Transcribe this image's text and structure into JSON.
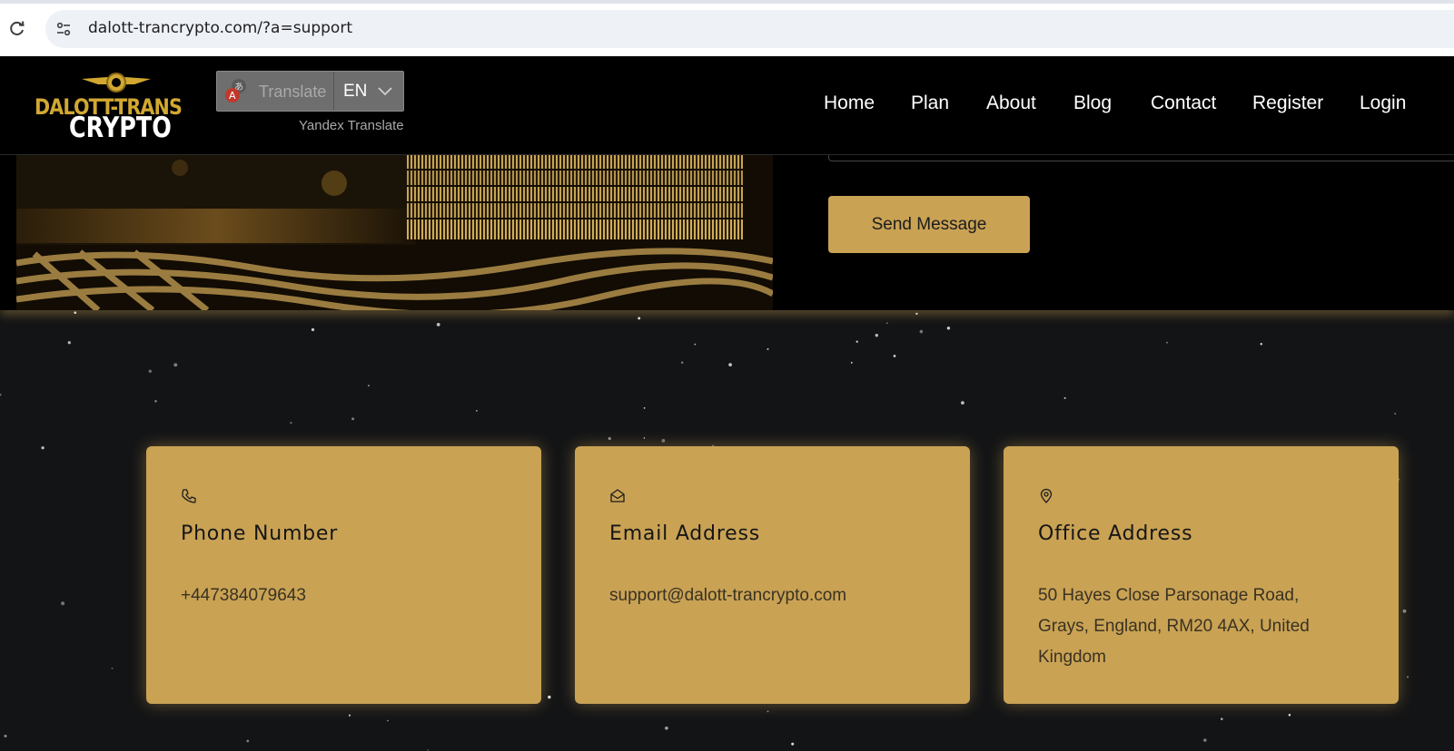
{
  "browser": {
    "url": "dalott-trancrypto.com/?a=support"
  },
  "header": {
    "logo": {
      "line1": "DALOTT-TRANS",
      "line2": "CRYPTO"
    },
    "translate": {
      "label": "Translate",
      "language": "EN",
      "provider": "Yandex Translate"
    },
    "nav": [
      {
        "label": "Home"
      },
      {
        "label": "Plan"
      },
      {
        "label": "About"
      },
      {
        "label": "Blog"
      },
      {
        "label": "Contact"
      },
      {
        "label": "Register"
      },
      {
        "label": "Login"
      }
    ]
  },
  "form": {
    "send_label": "Send Message"
  },
  "cards": [
    {
      "icon": "phone-icon",
      "title": "Phone Number",
      "text": "+447384079643"
    },
    {
      "icon": "envelope-icon",
      "title": "Email Address",
      "text": "support@dalott-trancrypto.com"
    },
    {
      "icon": "location-pin-icon",
      "title": "Office Address",
      "text": "50 Hayes Close Parsonage Road, Grays, England, RM20 4AX, United Kingdom"
    }
  ],
  "colors": {
    "accent_gold": "#c9a254",
    "logo_gold": "#d2a830",
    "background": "#131416",
    "header_bg": "#000000"
  }
}
